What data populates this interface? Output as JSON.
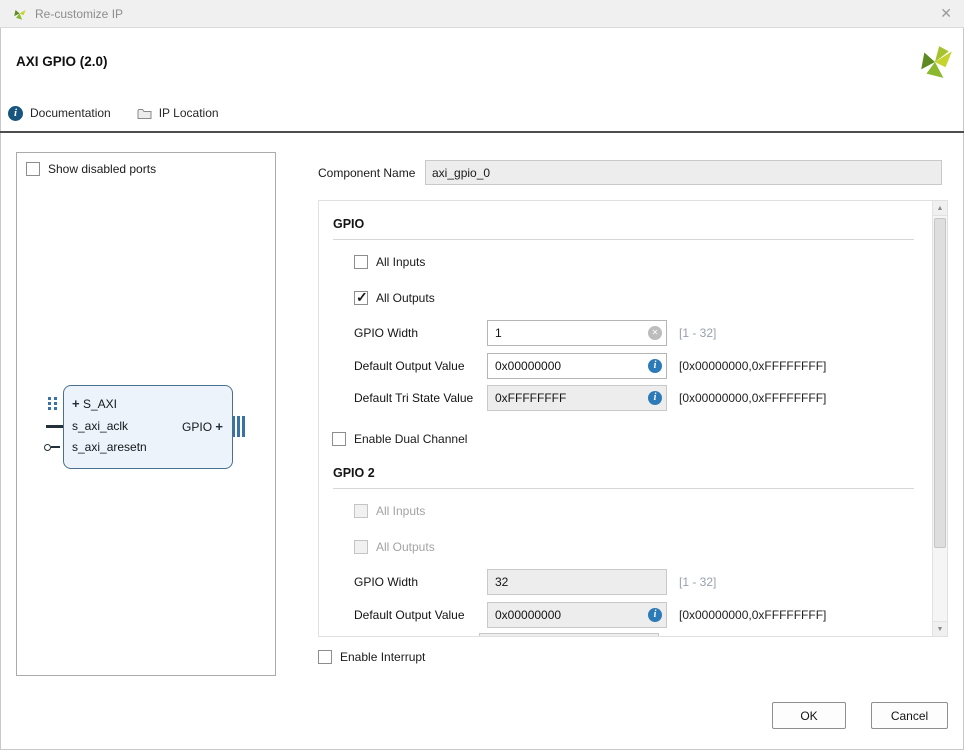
{
  "window": {
    "title": "Re-customize IP"
  },
  "header": {
    "title": "AXI GPIO (2.0)"
  },
  "toolbar": {
    "documentation": "Documentation",
    "ip_location": "IP Location"
  },
  "left_panel": {
    "show_disabled_ports": {
      "label": "Show disabled ports",
      "checked": false
    },
    "block": {
      "interface_in": "S_AXI",
      "clk_port": "s_axi_aclk",
      "reset_port": "s_axi_aresetn",
      "interface_out": "GPIO"
    }
  },
  "component_name": {
    "label": "Component Name",
    "value": "axi_gpio_0"
  },
  "config": {
    "gpio": {
      "title": "GPIO",
      "all_inputs": {
        "label": "All Inputs",
        "checked": false
      },
      "all_outputs": {
        "label": "All Outputs",
        "checked": true
      },
      "gpio_width": {
        "label": "GPIO Width",
        "value": "1",
        "range": "[1 - 32]"
      },
      "default_output_value": {
        "label": "Default Output Value",
        "value": "0x00000000",
        "range": "[0x00000000,0xFFFFFFFF]"
      },
      "default_tri_state_value": {
        "label": "Default Tri State Value",
        "value": "0xFFFFFFFF",
        "range": "[0x00000000,0xFFFFFFFF]"
      },
      "enable_dual_channel": {
        "label": "Enable Dual Channel",
        "checked": false
      }
    },
    "gpio2": {
      "title": "GPIO 2",
      "all_inputs": {
        "label": "All Inputs",
        "checked": false
      },
      "all_outputs": {
        "label": "All Outputs",
        "checked": false
      },
      "gpio_width": {
        "label": "GPIO Width",
        "value": "32",
        "range": "[1 - 32]"
      },
      "default_output_value": {
        "label": "Default Output Value",
        "value": "0x00000000",
        "range": "[0x00000000,0xFFFFFFFF]"
      }
    }
  },
  "enable_interrupt": {
    "label": "Enable Interrupt",
    "checked": false
  },
  "footer": {
    "ok": "OK",
    "cancel": "Cancel"
  },
  "icons": {
    "close": "✕",
    "info": "i",
    "clear": "✕",
    "plus": "+",
    "scroll_up": "▲",
    "scroll_down": "▼"
  },
  "colors": {
    "info_icon_blue": "#2d7ab8",
    "ip_box_fill": "#edf3fa",
    "ip_box_border": "#49708f",
    "logo_green": "#8ab82e",
    "logo_lime": "#c4d42c"
  }
}
